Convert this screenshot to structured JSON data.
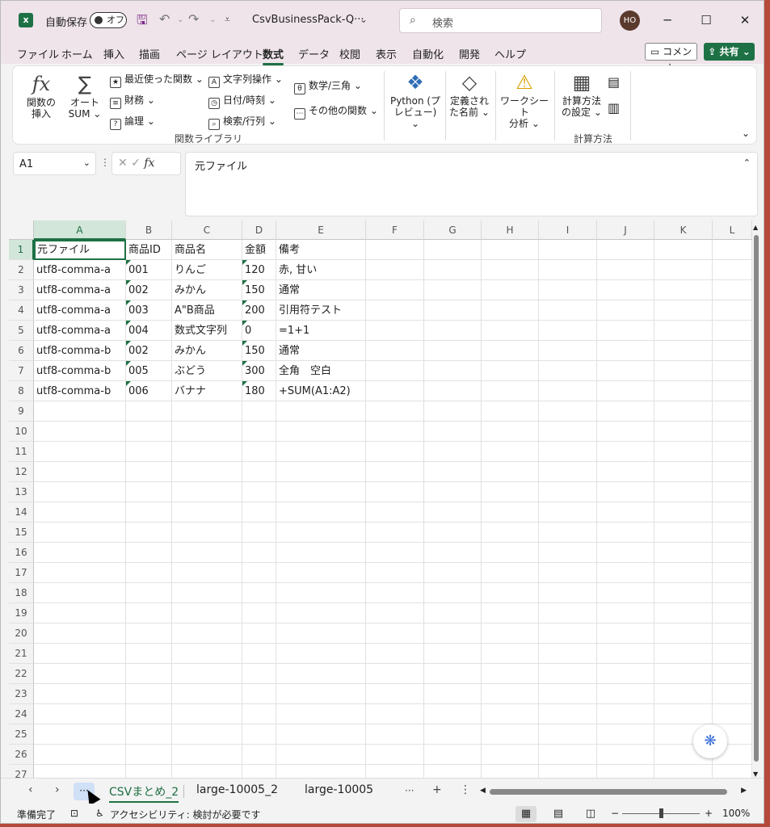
{
  "titlebar": {
    "autosave_label": "自動保存",
    "autosave_state": "オフ",
    "doc_title": "CsvBusinessPack-Q···",
    "search_placeholder": "検索",
    "avatar_initials": "HO"
  },
  "menu": {
    "items": [
      "ファイル",
      "ホーム",
      "挿入",
      "描画",
      "ページ レイアウト",
      "数式",
      "データ",
      "校閲",
      "表示",
      "自動化",
      "開発",
      "ヘルプ"
    ],
    "active": "数式",
    "comment_label": "コメント",
    "share_label": "共有"
  },
  "ribbon": {
    "insert_function": "関数の\n挿入",
    "autosum_1": "オート",
    "autosum_2": "SUM",
    "recent": "最近使った関数",
    "financial": "財務",
    "logical": "論理",
    "text": "文字列操作",
    "datetime": "日付/時刻",
    "lookup": "検索/行列",
    "math": "数学/三角",
    "more": "その他の関数",
    "group_library": "関数ライブラリ",
    "python_1": "Python (プ",
    "python_2": "レビュー)",
    "names_1": "定義され",
    "names_2": "た名前",
    "audit_1": "ワークシート",
    "audit_2": "分析",
    "calc_1": "計算方法",
    "calc_2": "の設定",
    "group_calc": "計算方法"
  },
  "formula_bar": {
    "name_box": "A1",
    "fx": "fx",
    "content": "元ファイル"
  },
  "grid": {
    "columns": [
      "A",
      "B",
      "C",
      "D",
      "E",
      "F",
      "G",
      "H",
      "I",
      "J",
      "K",
      "L"
    ],
    "rows": [
      [
        "元ファイル",
        "商品ID",
        "商品名",
        "金額",
        "備考"
      ],
      [
        "utf8-comma-a",
        "001",
        "りんご",
        "120",
        "赤, 甘い"
      ],
      [
        "utf8-comma-a",
        "002",
        "みかん",
        "150",
        "通常"
      ],
      [
        "utf8-comma-a",
        "003",
        "A\"B商品",
        "200",
        "引用符テスト"
      ],
      [
        "utf8-comma-a",
        "004",
        "数式文字列",
        "0",
        "=1+1"
      ],
      [
        "utf8-comma-b",
        "002",
        "みかん",
        "150",
        "通常"
      ],
      [
        "utf8-comma-b",
        "005",
        "ぶどう",
        "300",
        "全角　空白"
      ],
      [
        "utf8-comma-b",
        "006",
        "バナナ",
        "180",
        "+SUM(A1:A2)"
      ]
    ],
    "row_count": 27
  },
  "sheets": {
    "tabs": [
      "CSVまとめ_2",
      "large-10005_2",
      "large-10005"
    ],
    "active": "CSVまとめ_2",
    "more_label": "···"
  },
  "status": {
    "ready": "準備完了",
    "accessibility": "アクセシビリティ: 検討が必要です",
    "zoom": "100%"
  },
  "colors": {
    "accent": "#1e7145",
    "title_bg": "#efe4ea"
  }
}
